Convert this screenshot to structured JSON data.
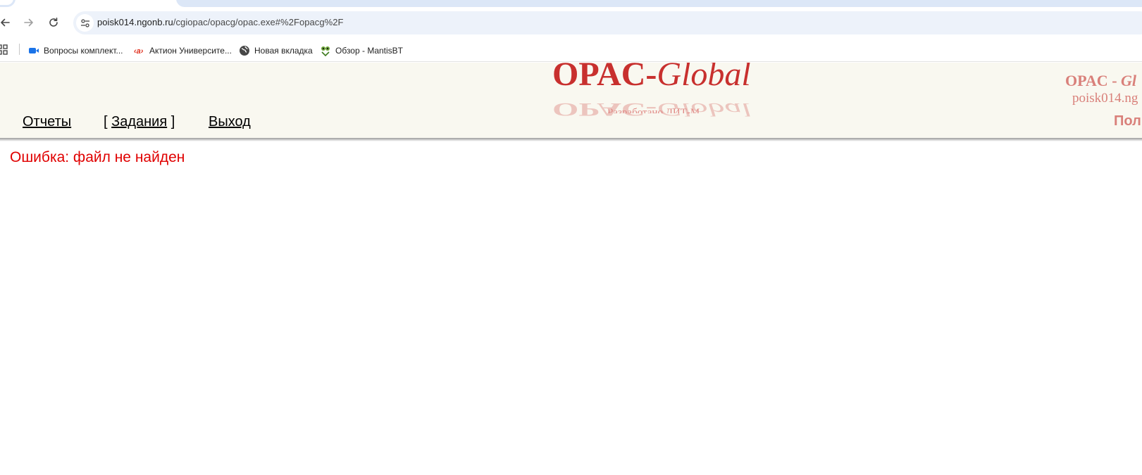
{
  "browser": {
    "address_bar": {
      "host": "poisk014.ngonb.ru",
      "path": "/cgiopac/opacg/opac.exe#%2Fopacg%2F"
    },
    "bookmarks": [
      {
        "label": "Вопросы комплект...",
        "icon": "video-camera-icon"
      },
      {
        "label": "Актион Университе...",
        "icon": "aktion-logo-icon"
      },
      {
        "label": "Новая вкладка",
        "icon": "globe-icon"
      },
      {
        "label": "Обзор - MantisBT",
        "icon": "mantis-icon"
      }
    ]
  },
  "header": {
    "logo": {
      "part1": "OPAC-",
      "part2": "Global"
    },
    "developer_caption": "Разработано ЛИТ-М",
    "menu": {
      "reports": "Отчеты",
      "tasks_open": "[ ",
      "tasks": "Задания",
      "tasks_close": " ]",
      "exit": "Выход"
    },
    "right_title": {
      "part1": "OPAC - ",
      "part2": "Gl"
    },
    "right_host": "poisk014.ng",
    "right_user": "Пол"
  },
  "main": {
    "error_message": "Ошибка: файл не найден"
  },
  "colors": {
    "header_bg": "#f9f8f0",
    "logo": "#c8302e",
    "right_text": "#d9807a",
    "error": "#e00000"
  }
}
